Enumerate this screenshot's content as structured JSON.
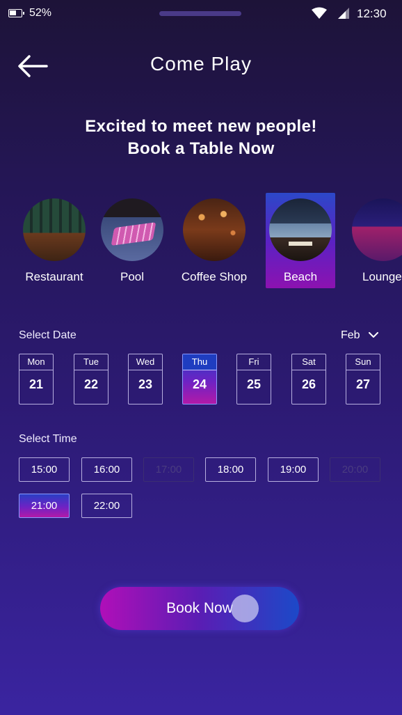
{
  "status_bar": {
    "battery": "52%",
    "time": "12:30"
  },
  "header": {
    "title": "Come Play"
  },
  "headline": {
    "line1": "Excited to meet new people!",
    "line2": "Book a Table Now"
  },
  "venues": [
    {
      "label": "Restaurant",
      "selected": false
    },
    {
      "label": "Pool",
      "selected": false
    },
    {
      "label": "Coffee Shop",
      "selected": false
    },
    {
      "label": "Beach",
      "selected": true
    },
    {
      "label": "Lounge",
      "selected": false
    }
  ],
  "date_section": {
    "label": "Select Date",
    "month": "Feb",
    "dates": [
      {
        "dow": "Mon",
        "day": "21",
        "selected": false
      },
      {
        "dow": "Tue",
        "day": "22",
        "selected": false
      },
      {
        "dow": "Wed",
        "day": "23",
        "selected": false
      },
      {
        "dow": "Thu",
        "day": "24",
        "selected": true
      },
      {
        "dow": "Fri",
        "day": "25",
        "selected": false
      },
      {
        "dow": "Sat",
        "day": "26",
        "selected": false
      },
      {
        "dow": "Sun",
        "day": "27",
        "selected": false
      }
    ]
  },
  "time_section": {
    "label": "Select Time",
    "slots": [
      {
        "time": "15:00",
        "state": "available"
      },
      {
        "time": "16:00",
        "state": "available"
      },
      {
        "time": "17:00",
        "state": "disabled"
      },
      {
        "time": "18:00",
        "state": "available"
      },
      {
        "time": "19:00",
        "state": "available"
      },
      {
        "time": "20:00",
        "state": "disabled"
      },
      {
        "time": "21:00",
        "state": "selected"
      },
      {
        "time": "22:00",
        "state": "available"
      }
    ]
  },
  "actions": {
    "book_label": "Book Now"
  },
  "colors": {
    "background_top": "#1d1338",
    "background_bottom": "#3a24a0",
    "accent_blue": "#1f3dc0",
    "accent_magenta": "#b21aa8"
  },
  "icons": {
    "back": "arrow-left-icon",
    "month_dropdown": "chevron-down-icon",
    "wifi": "wifi-icon",
    "cell": "cell-signal-icon",
    "battery": "battery-icon"
  }
}
